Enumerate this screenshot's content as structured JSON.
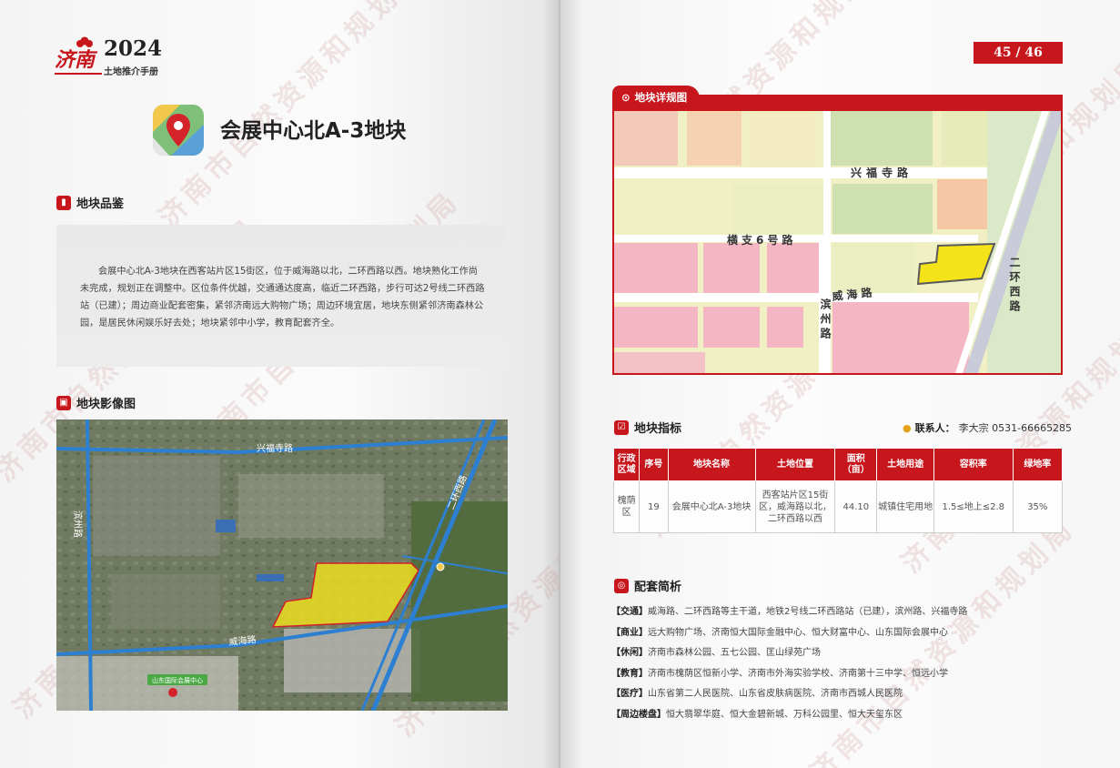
{
  "left": {
    "logo": {
      "glyph": "济南",
      "year": "2024",
      "subtitle": "土地推介手册"
    },
    "title": "会展中心北A-3地块",
    "appraisal": {
      "heading": "地块品鉴",
      "text": "会展中心北A-3地块在西客站片区15街区，位于威海路以北，二环西路以西。地块熟化工作尚未完成，规划正在调整中。区位条件优越，交通通达度高，临近二环西路，步行可达2号线二环西路站（已建）；周边商业配套密集，紧邻济南远大购物广场；周边环境宜居，地块东侧紧邻济南森林公园，是居民休闲娱乐好去处；地块紧邻中小学，教育配套齐全。"
    },
    "satellite": {
      "heading": "地块影像图",
      "labels": {
        "xingfusi": "兴福寺路",
        "binzhou": "滨州路",
        "erhuan": "二环西路",
        "weihai": "威海路",
        "expo": "山东国际会展中心"
      }
    },
    "watermark": "济南市自然资源和规划局"
  },
  "right": {
    "page_number": "45 / 46",
    "map": {
      "heading": "地块详规图",
      "labels": {
        "xingfusi": "兴福寺路",
        "hengzhi": "横支6号路",
        "weihai": "威海路",
        "binzhou": "滨州路",
        "erhuan": "二环西路"
      }
    },
    "indicators": {
      "heading": "地块指标",
      "contact_label": "联系人：",
      "contact_value": "李大宗 0531-66665285",
      "columns": [
        "行政区域",
        "序号",
        "地块名称",
        "土地位置",
        "面积（亩）",
        "土地用途",
        "容积率",
        "绿地率"
      ],
      "row": [
        "槐荫区",
        "19",
        "会展中心北A-3地块",
        "西客站片区15街区，威海路以北，二环西路以西",
        "44.10",
        "城镇住宅用地",
        "1.5≤地上≤2.8",
        "35%"
      ]
    },
    "support": {
      "heading": "配套简析",
      "items": [
        {
          "tag": "【交通】",
          "text": "威海路、二环西路等主干道，地铁2号线二环西路站（已建），滨州路、兴福寺路"
        },
        {
          "tag": "【商业】",
          "text": "远大购物广场、济南恒大国际金融中心、恒大财富中心、山东国际会展中心"
        },
        {
          "tag": "【休闲】",
          "text": "济南市森林公园、五七公园、匡山绿苑广场"
        },
        {
          "tag": "【教育】",
          "text": "济南市槐荫区恒新小学、济南市外海实验学校、济南第十三中学、恒远小学"
        },
        {
          "tag": "【医疗】",
          "text": "山东省第二人民医院、山东省皮肤病医院、济南市西城人民医院"
        },
        {
          "tag": "【周边楼盘】",
          "text": "恒大翡翠华庭、恒大金碧新城、万科公园里、恒大天玺东区"
        }
      ]
    }
  },
  "colors": {
    "brand_red": "#c8161d",
    "parcel_yellow": "#f5e31a"
  }
}
